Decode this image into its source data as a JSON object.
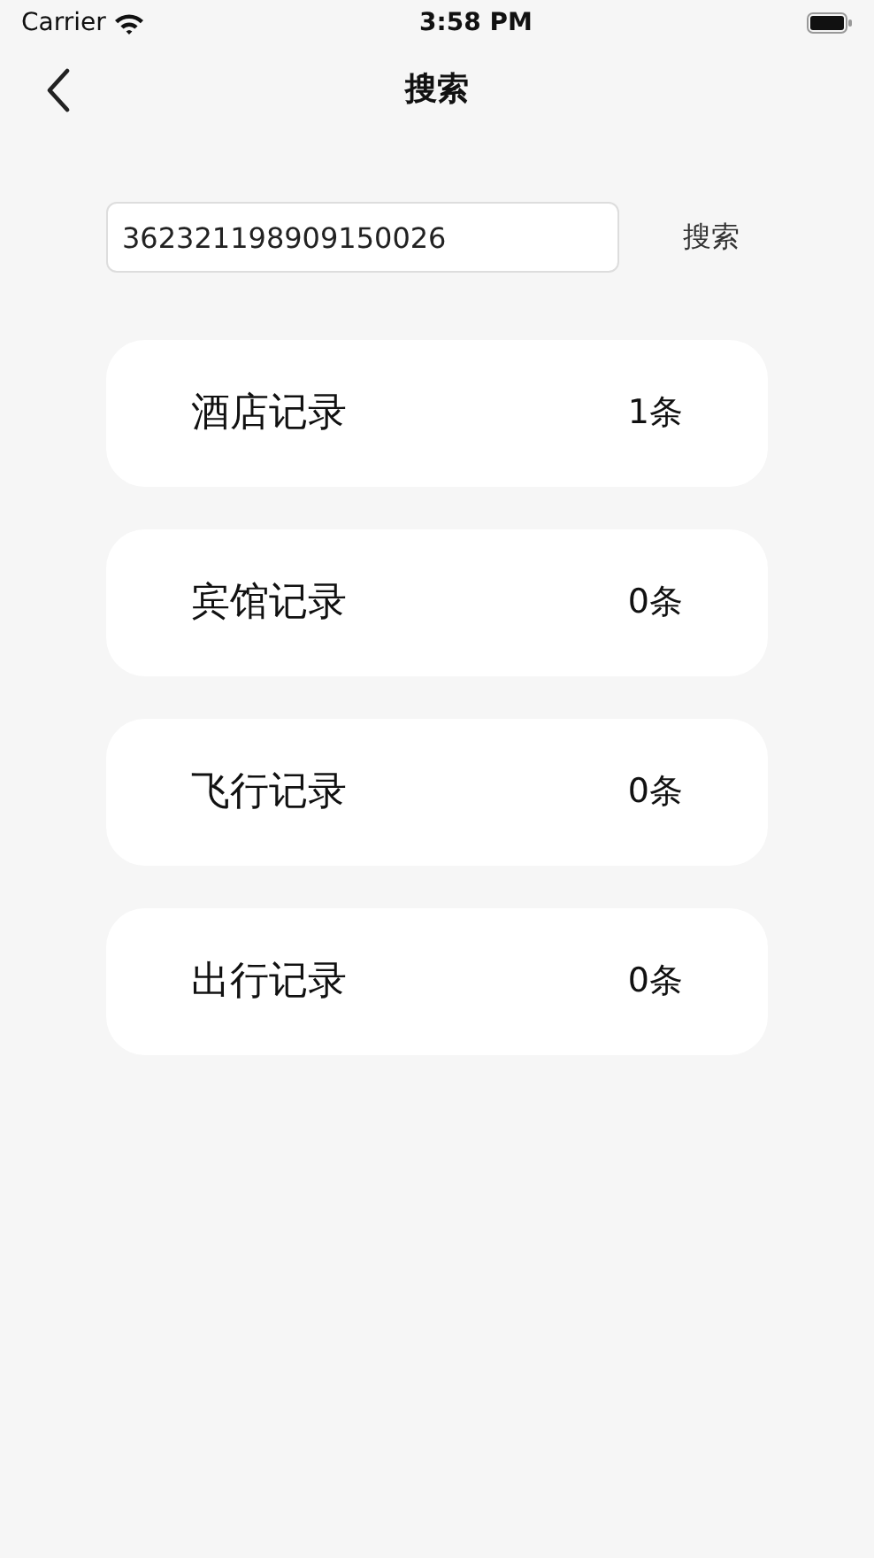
{
  "status_bar": {
    "carrier": "Carrier",
    "time": "3:58 PM"
  },
  "nav": {
    "title": "搜索"
  },
  "search": {
    "value": "362321198909150026",
    "button": "搜索"
  },
  "records": [
    {
      "label": "酒店记录",
      "count": "1条"
    },
    {
      "label": "宾馆记录",
      "count": "0条"
    },
    {
      "label": "飞行记录",
      "count": "0条"
    },
    {
      "label": "出行记录",
      "count": "0条"
    }
  ]
}
